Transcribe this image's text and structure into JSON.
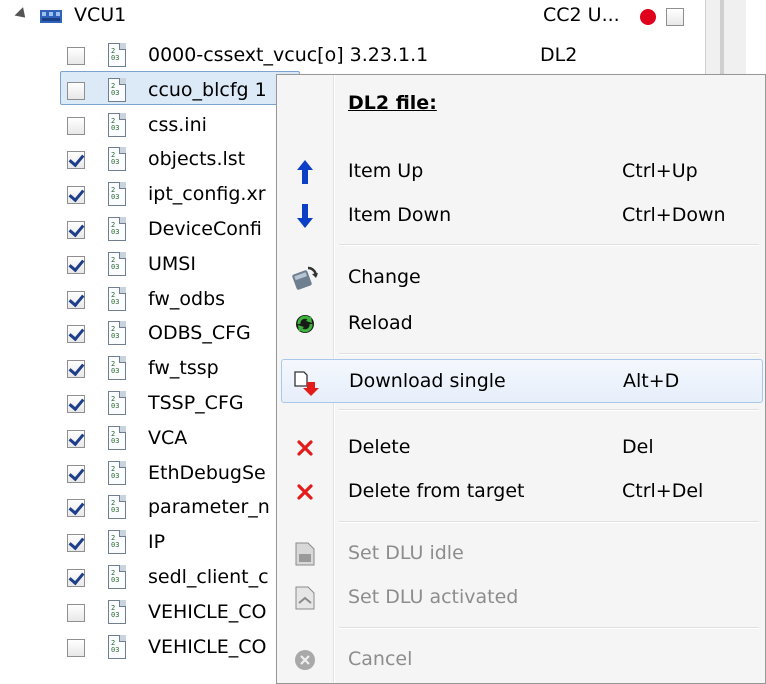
{
  "tree": {
    "root": {
      "label": "VCU1",
      "col2": "CC2 U...",
      "status_color": "#e0001b"
    },
    "items": [
      {
        "label": "0000-cssext_vcuc[o] 3.23.1.1",
        "col2": "DL2",
        "checked": false
      },
      {
        "label": "ccuo_blcfg 1",
        "col2": "",
        "checked": false
      },
      {
        "label": "css.ini",
        "col2": "",
        "checked": false
      },
      {
        "label": "objects.lst",
        "col2": "",
        "checked": true
      },
      {
        "label": "ipt_config.xr",
        "col2": "",
        "checked": true
      },
      {
        "label": "DeviceConfi",
        "col2": "",
        "checked": true
      },
      {
        "label": "UMSI",
        "col2": "",
        "checked": true
      },
      {
        "label": "fw_odbs",
        "col2": "",
        "checked": true
      },
      {
        "label": "ODBS_CFG",
        "col2": "",
        "checked": true
      },
      {
        "label": "fw_tssp",
        "col2": "",
        "checked": true
      },
      {
        "label": "TSSP_CFG",
        "col2": "",
        "checked": true
      },
      {
        "label": "VCA",
        "col2": "",
        "checked": true
      },
      {
        "label": "EthDebugSe",
        "col2": "",
        "checked": true
      },
      {
        "label": "parameter_n",
        "col2": "",
        "checked": true
      },
      {
        "label": "IP",
        "col2": "",
        "checked": true
      },
      {
        "label": "sedl_client_c",
        "col2": "",
        "checked": true
      },
      {
        "label": "VEHICLE_CO",
        "col2": "",
        "checked": false
      },
      {
        "label": "VEHICLE_CO",
        "col2": "",
        "checked": false
      }
    ]
  },
  "context_menu": {
    "header": "DL2 file:",
    "items": {
      "item_up": {
        "label": "Item Up",
        "shortcut": "Ctrl+Up",
        "icon": "arrow-up-icon"
      },
      "item_down": {
        "label": "Item Down",
        "shortcut": "Ctrl+Down",
        "icon": "arrow-down-icon"
      },
      "change": {
        "label": "Change",
        "shortcut": "",
        "icon": "change-icon"
      },
      "reload": {
        "label": "Reload",
        "shortcut": "",
        "icon": "reload-icon"
      },
      "download_single": {
        "label": "Download single",
        "shortcut": "Alt+D",
        "icon": "download-icon"
      },
      "delete": {
        "label": "Delete",
        "shortcut": "Del",
        "icon": "red-x-icon"
      },
      "delete_from_target": {
        "label": "Delete from target",
        "shortcut": "Ctrl+Del",
        "icon": "red-x-icon"
      },
      "set_dlu_idle": {
        "label": "Set DLU idle",
        "shortcut": "",
        "icon": "dlu-idle-icon"
      },
      "set_dlu_activated": {
        "label": "Set DLU activated",
        "shortcut": "",
        "icon": "dlu-activated-icon"
      },
      "cancel": {
        "label": "Cancel",
        "shortcut": "",
        "icon": "cancel-icon"
      }
    }
  },
  "colors": {
    "accent_blue": "#0b3fc7",
    "delete_red": "#e31b1b",
    "hover_border": "#a8c7ea"
  }
}
